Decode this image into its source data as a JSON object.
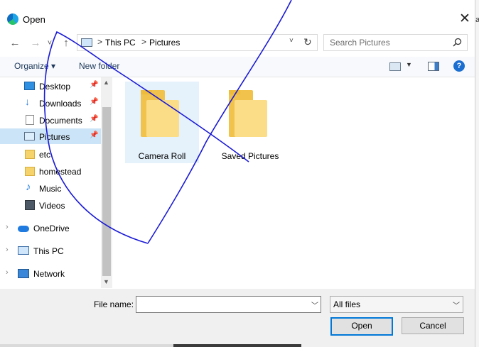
{
  "window": {
    "title": "Open",
    "close_symbol": "✕"
  },
  "background": {
    "peek_text": "a"
  },
  "nav": {
    "back": "←",
    "forward": "→",
    "recent": "˅",
    "up": "↑",
    "breadcrumb": [
      "This PC",
      "Pictures"
    ],
    "separator": ">",
    "dropdown": "˅",
    "refresh": "↻"
  },
  "search": {
    "placeholder": "Search Pictures",
    "icon": "search-icon"
  },
  "toolbar": {
    "organize": "Organize ▾",
    "new_folder": "New folder",
    "view_dropdown": "▼",
    "help": "?"
  },
  "sidebar": {
    "quick_access": [
      {
        "label": "Desktop",
        "icon": "desktop-icon",
        "pinned": true
      },
      {
        "label": "Downloads",
        "icon": "download-icon",
        "pinned": true
      },
      {
        "label": "Documents",
        "icon": "document-icon",
        "pinned": true
      },
      {
        "label": "Pictures",
        "icon": "pictures-icon",
        "pinned": true,
        "selected": true
      },
      {
        "label": "etc",
        "icon": "folder-icon"
      },
      {
        "label": "homestead",
        "icon": "folder-icon"
      },
      {
        "label": "Music",
        "icon": "music-icon"
      },
      {
        "label": "Videos",
        "icon": "video-icon"
      }
    ],
    "roots": [
      {
        "label": "OneDrive",
        "icon": "cloud-icon"
      },
      {
        "label": "This PC",
        "icon": "computer-icon"
      },
      {
        "label": "Network",
        "icon": "network-icon"
      }
    ],
    "pin_symbol": "📌",
    "expand_symbol": "›"
  },
  "files": [
    {
      "name": "Camera Roll",
      "selected": true
    },
    {
      "name": "Saved Pictures",
      "selected": false
    }
  ],
  "footer": {
    "file_name_label": "File name:",
    "file_name_value": "",
    "file_type": "All files",
    "open": "Open",
    "cancel": "Cancel"
  },
  "colors": {
    "accent": "#0078d7",
    "selection": "#cce4f7",
    "ink": "#1a1ad6"
  }
}
